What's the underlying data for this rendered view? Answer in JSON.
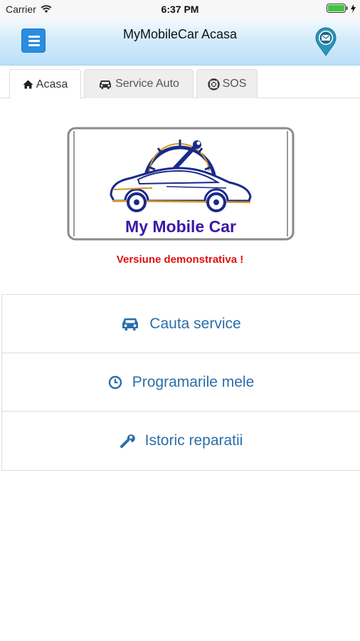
{
  "status_bar": {
    "carrier": "Carrier",
    "time": "6:37 PM"
  },
  "header": {
    "title": "MyMobileCar Acasa",
    "menu_icon": "hamburger-icon",
    "right_icon": "map-pin-mail-icon"
  },
  "tabs": [
    {
      "label": "Acasa",
      "icon": "home-icon",
      "active": true
    },
    {
      "label": "Service Auto",
      "icon": "car-icon",
      "active": false
    },
    {
      "label": "SOS",
      "icon": "lifebuoy-icon",
      "active": false
    }
  ],
  "logo": {
    "text": "My Mobile Car"
  },
  "demo_notice": "Versiune demonstrativa !",
  "menu": [
    {
      "label": "Cauta service",
      "icon": "car-icon"
    },
    {
      "label": "Programarile mele",
      "icon": "clock-icon"
    },
    {
      "label": "Istoric reparatii",
      "icon": "wrench-icon"
    }
  ],
  "colors": {
    "accent": "#2a8de0",
    "link": "#2a6eaa",
    "demo_red": "#e01010",
    "logo_text": "#3a18a8"
  }
}
